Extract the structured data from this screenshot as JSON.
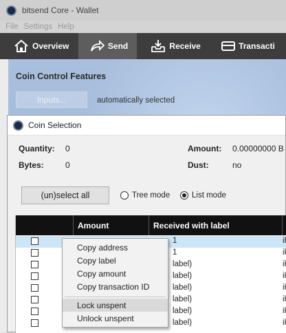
{
  "window": {
    "title": "bitsend Core - Wallet"
  },
  "menu": [
    "File",
    "Settings",
    "Help"
  ],
  "toolbar": {
    "overview": "Overview",
    "send": "Send",
    "receive": "Receive",
    "transactions": "Transacti"
  },
  "coin_control": {
    "title": "Coin Control Features",
    "inputs_button": "Inputs...",
    "status": "automatically selected"
  },
  "dialog": {
    "title": "Coin Selection",
    "quantity_label": "Quantity:",
    "quantity_value": "0",
    "bytes_label": "Bytes:",
    "bytes_value": "0",
    "amount_label": "Amount:",
    "amount_value": "0.00000000 B",
    "dust_label": "Dust:",
    "dust_value": "no",
    "select_all": "(un)select all",
    "tree_mode": "Tree mode",
    "list_mode": "List mode",
    "selected_mode": "list"
  },
  "table": {
    "columns": [
      "Amount",
      "Received with label",
      "R"
    ],
    "rows": [
      {
        "amount": "",
        "label": "1",
        "addr": "iF"
      },
      {
        "amount": "",
        "label": "1",
        "addr": "iF"
      },
      {
        "amount": "",
        "label": "label)",
        "addr": "iK"
      },
      {
        "amount": "",
        "label": "label)",
        "addr": "iK"
      },
      {
        "amount": "",
        "label": "label)",
        "addr": "iK"
      },
      {
        "amount": "",
        "label": "label)",
        "addr": "iK"
      },
      {
        "amount": "",
        "label": "label)",
        "addr": "iK"
      },
      {
        "amount": "",
        "label": "label)",
        "addr": "iK"
      }
    ]
  },
  "context_menu": {
    "items": [
      "Copy address",
      "Copy label",
      "Copy amount",
      "Copy transaction ID"
    ],
    "items2": [
      "Lock unspent",
      "Unlock unspent"
    ]
  }
}
